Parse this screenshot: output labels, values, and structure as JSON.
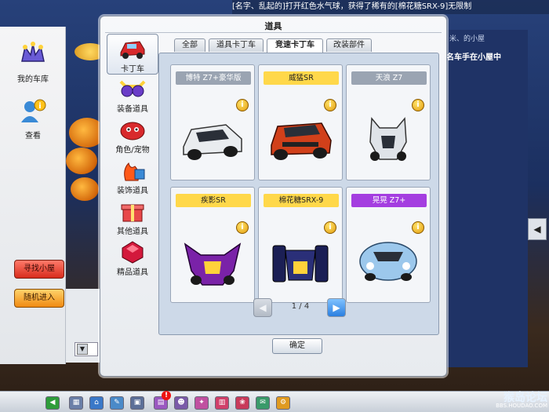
{
  "system_message": "[名字、乱起的]打开红色水气球，获得了稀有的[棉花糖SRX-9]无限制",
  "left_sidebar": {
    "items": [
      {
        "label": "我的车库",
        "icon": "crown-garage-icon"
      },
      {
        "label": "查看",
        "icon": "user-info-icon"
      }
    ],
    "buttons": [
      {
        "label": "寻找小屋",
        "color": "#d72c1c"
      },
      {
        "label": "随机进入",
        "color": "#f08a12"
      }
    ]
  },
  "right_panel": {
    "title": "名车手在小屋中",
    "subtitle": "米、的小屋"
  },
  "dialog": {
    "title": "道具",
    "categories": [
      {
        "label": "卡丁车",
        "icon": "kart-icon",
        "active": true
      },
      {
        "label": "装备道具",
        "icon": "goggles-icon",
        "active": false
      },
      {
        "label": "角色/宠物",
        "icon": "character-pet-icon",
        "active": false
      },
      {
        "label": "装饰道具",
        "icon": "decoration-icon",
        "active": false
      },
      {
        "label": "其他道具",
        "icon": "giftbox-icon",
        "active": false
      },
      {
        "label": "精品道具",
        "icon": "gem-icon",
        "active": false
      }
    ],
    "tabs": [
      {
        "label": "全部",
        "active": false
      },
      {
        "label": "道具卡丁车",
        "active": false
      },
      {
        "label": "竞速卡丁车",
        "active": true
      },
      {
        "label": "改装部件",
        "active": false
      }
    ],
    "cards": [
      {
        "name": "博特 Z7+豪华版",
        "grade": "normal",
        "body_color": "#e9ecef"
      },
      {
        "name": "威猛SR",
        "grade": "sr",
        "body_color": "#d1401a"
      },
      {
        "name": "天浪 Z7",
        "grade": "normal",
        "body_color": "#dfe3e8"
      },
      {
        "name": "疾影SR",
        "grade": "sr",
        "body_color": "#7a22a8"
      },
      {
        "name": "棉花糖SRX-9",
        "grade": "sr",
        "body_color": "#1b1f55"
      },
      {
        "name": "晃晃 Z7+",
        "grade": "purple",
        "body_color": "#9cc8ec"
      }
    ],
    "pager": {
      "text": "1 / 4",
      "prev_glyph": "◀",
      "next_glyph": "▶"
    },
    "ok_label": "确定"
  },
  "taskbar": {
    "badge": "!",
    "watermark": "猴岛论坛",
    "watermark_sub": "BBS.HOUDAO.COM"
  },
  "colors": {
    "grade_normal": "#9aa4b2",
    "grade_sr": "#ffd84a",
    "grade_purple": "#a43ee0",
    "next_button": "#2b7fe0"
  }
}
